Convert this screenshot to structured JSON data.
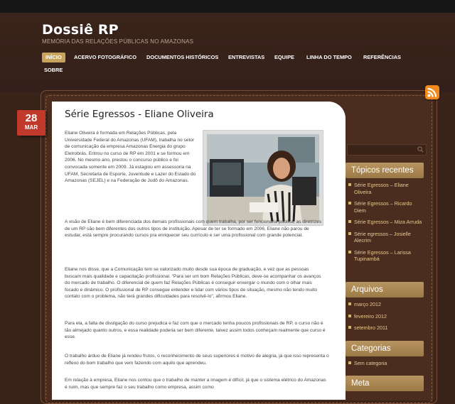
{
  "site": {
    "title": "Dossiê RP",
    "tagline": "MEMÓRIA DAS RELAÇÕES PÚBLICAS NO AMAZONAS"
  },
  "nav": {
    "items": [
      "INÍCIO",
      "ACERVO FOTOGRÁFICO",
      "DOCUMENTOS HISTÓRICOS",
      "ENTREVISTAS",
      "EQUIPE",
      "LINHA DO TEMPO",
      "REFERÊNCIAS",
      "SOBRE"
    ],
    "active": "INÍCIO"
  },
  "post": {
    "date_day": "28",
    "date_month": "MAR",
    "title": "Série Egressos - Eliane Oliveira",
    "paragraphs": [
      "Eliane Oliveira é formada em Relações Públicas, pela Universidade Federal do Amazonas (UFAM), trabalha no setor de comunicação da empresa Amazonas Energia do grupo Eletrobrás. Entrou no curso de RP em 2001 e se formou em 2006. No mesmo ano, prestou o concurso público e foi convocada somente em 2009. Já estagiou em assessoria na UFAM, Secretaria de Esporte, Juventude e Lazer do Estado do Amazonas (SEJEL) e na Federação de Judô do Amazonas.",
      "A visão de Eliane é bem diferenciada dos demais profissionais com quem trabalha, por ser funcionária pública, as diretrizes de um RP são bem diferentes dos outros tipos de instituição. Apesar de ter se formado em 2006, Eliane não parou de estudar, está sempre procurando cursos pra enriquecer seu currículo e ser uma profissional com grande potencial.",
      "Eliane nos disse, que a Comunicação tem se valorizado muito desde sua época de graduação, e vez que as pessoas buscam mais qualidade e capacitação profissional. \"Para ser um bom Relações Públicas, deve-se acompanhar os avanços do mercado de trabalho. O diferencial de quem faz Relações Públicas é conseguir enxergar o mundo com o olhar mais focado e dinâmico. O profissional de RP consegue entender e lidar com vários tipos de situação, mesmo não tendo muito contato com o problema, não terá grandes dificuldades para resolvê-lo\", afirmou Eliane.",
      "Para ela, a falta de divulgação do curso prejudica e faz com que o mercado tenha poucos profissionais de RP, o curso não é tão almejado quanto outros, e essa realidade poderia ser bem diferente, talvez assim todos conheçam realmente que curso é esse.",
      "O trabalho árduo de Eliane já rendeu frutos, o reconhecimento de seus superiores é motivo de alegria, já que isso representa o reflexo do bom trabalho que vem fazendo com aquilo que aprendeu.",
      "Em relação à empresa, Eliane nos contou que o trabalho de manter a imagem é difícil, já que o sistema elétrico do Amazonas é ruim, mas que sempre faz o seu trabalho como empresa, assim como"
    ]
  },
  "sidebar": {
    "recent_title": "Tópicos recentes",
    "recent": [
      "Série Egressos – Eliane Oliveira",
      "Série Egressos – Ricardo Diem",
      "Série Egressos – Miza Arruda",
      "Série egressos – Josielle Alecrim",
      "Série Egressos – Larissa Tupinambá"
    ],
    "archives_title": "Arquivos",
    "archives": [
      "março 2012",
      "fevereiro 2012",
      "setembro 2011"
    ],
    "categories_title": "Categorias",
    "categories": [
      "Sem categoria"
    ],
    "meta_title": "Meta"
  },
  "icons": {
    "rss": "rss-icon",
    "search": "search-icon"
  }
}
